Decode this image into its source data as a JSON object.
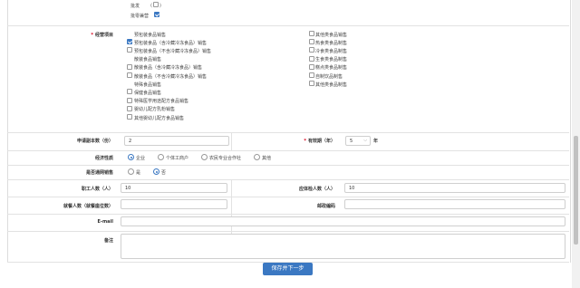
{
  "top_rows": [
    {
      "label": "批发",
      "paren_open": "（",
      "paren_close": "）"
    },
    {
      "label": "批零兼营",
      "paren_open": "（",
      "paren_close": "）"
    }
  ],
  "business_items": {
    "label": "经营项目",
    "left": [
      {
        "text": "预包装食品销售",
        "check": false,
        "show": false
      },
      {
        "text": "预包装食品（含冷藏冷冻食品）销售",
        "check": true,
        "show": true
      },
      {
        "text": "预包装食品（不含冷藏冷冻食品）销售",
        "check": false,
        "show": true
      },
      {
        "text": "散装食品销售",
        "check": false,
        "show": false
      },
      {
        "text": "散装食品（含冷藏冷冻食品）销售",
        "check": false,
        "show": true
      },
      {
        "text": "散装食品（不含冷藏冷冻食品）销售",
        "check": false,
        "show": true
      },
      {
        "text": "特殊食品销售",
        "check": false,
        "show": false
      },
      {
        "text": "保健食品销售",
        "check": false,
        "show": true
      },
      {
        "text": "特殊医学用途配方食品销售",
        "check": false,
        "show": true
      },
      {
        "text": "婴幼儿配方乳粉销售",
        "check": false,
        "show": true
      },
      {
        "text": "其他婴幼儿配方食品销售",
        "check": false,
        "show": true
      }
    ],
    "right": [
      {
        "text": "其他类食品销售"
      },
      {
        "text": "热食类食品制售"
      },
      {
        "text": "冷食类食品制售"
      },
      {
        "text": "生食类食品制售"
      },
      {
        "text": "糕点类食品制售"
      },
      {
        "text": "自制饮品制售"
      },
      {
        "text": "其他类食品制售"
      }
    ]
  },
  "copies": {
    "label": "申请副本数（份）",
    "value": "2"
  },
  "validity": {
    "label": "有效期（年）",
    "value": "5",
    "unit": "年"
  },
  "economic": {
    "label": "经济性质",
    "options": [
      "企业",
      "个体工商户",
      "农民专业合作社",
      "其他"
    ],
    "selected": 0
  },
  "online": {
    "label": "是否通网销售",
    "options": [
      "是",
      "否"
    ],
    "selected": 1
  },
  "staff": {
    "label": "职工人数（人）",
    "value": "10"
  },
  "health_check": {
    "label": "应体检人数（人）",
    "value": "10"
  },
  "jobs": {
    "label": "就餐人数（就餐座位数）",
    "value": ""
  },
  "postcode": {
    "label": "邮政编码",
    "value": ""
  },
  "email": {
    "label": "E-mail",
    "value": ""
  },
  "remark": {
    "label": "备注",
    "value": ""
  },
  "save_button": "保存并下一步",
  "colors": {
    "accent": "#3b78c2",
    "required": "#d9001b"
  }
}
